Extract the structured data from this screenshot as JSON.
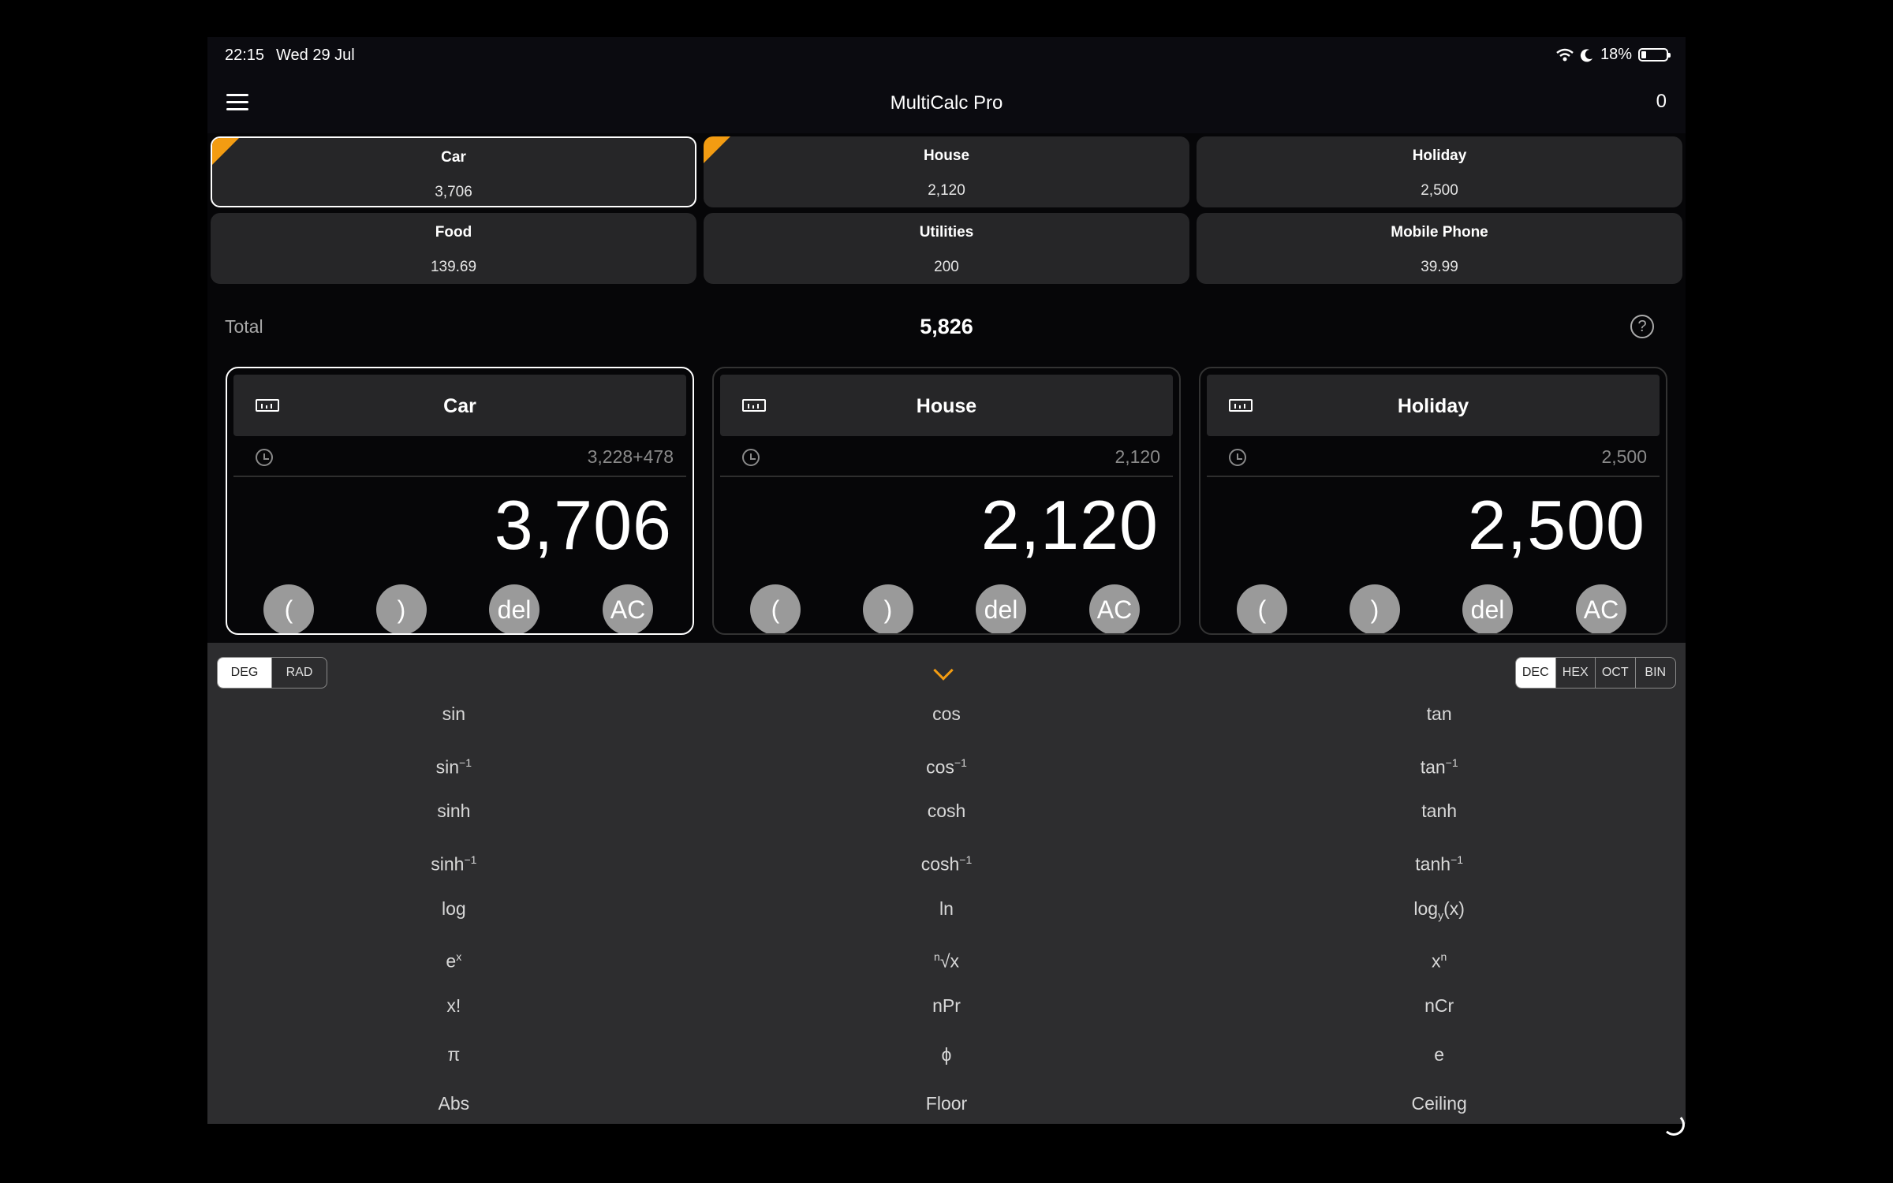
{
  "status": {
    "time": "22:15",
    "date": "Wed 29 Jul",
    "battery": "18%"
  },
  "navbar": {
    "title": "MultiCalc Pro",
    "count": "0"
  },
  "tiles": [
    {
      "name": "Car",
      "value": "3,706",
      "selected": true,
      "flag": true
    },
    {
      "name": "House",
      "value": "2,120",
      "selected": false,
      "flag": true
    },
    {
      "name": "Holiday",
      "value": "2,500",
      "selected": false,
      "flag": false
    },
    {
      "name": "Food",
      "value": "139.69",
      "selected": false,
      "flag": false
    },
    {
      "name": "Utilities",
      "value": "200",
      "selected": false,
      "flag": false
    },
    {
      "name": "Mobile Phone",
      "value": "39.99",
      "selected": false,
      "flag": false
    }
  ],
  "total": {
    "label": "Total",
    "value": "5,826",
    "help_icon": "question-circle-icon"
  },
  "calculators": [
    {
      "title": "Car",
      "history": "3,228+478",
      "display": "3,706",
      "active": true
    },
    {
      "title": "House",
      "history": "2,120",
      "display": "2,120",
      "active": false
    },
    {
      "title": "Holiday",
      "history": "2,500",
      "display": "2,500",
      "active": false
    }
  ],
  "keys": {
    "open": "(",
    "close": ")",
    "del": "del",
    "ac": "AC"
  },
  "angle_mode": {
    "options": [
      "DEG",
      "RAD"
    ],
    "selected": "DEG"
  },
  "base_mode": {
    "options": [
      "DEC",
      "HEX",
      "OCT",
      "BIN"
    ],
    "selected": "DEC"
  },
  "functions": {
    "sin": "sin",
    "cos": "cos",
    "tan": "tan",
    "asin": "sin",
    "acos": "cos",
    "atan": "tan",
    "inv_sup": "−1",
    "sinh": "sinh",
    "cosh": "cosh",
    "tanh": "tanh",
    "asinh": "sinh",
    "acosh": "cosh",
    "atanh": "tanh",
    "log": "log",
    "ln": "ln",
    "logy": "log",
    "logy_sub": "y",
    "logy_arg": "(x)",
    "ex": "e",
    "ex_sup": "x",
    "nroot": "√x",
    "nroot_sup": "n",
    "xn": "x",
    "xn_sup": "n",
    "fact": "x!",
    "npr": "nPr",
    "ncr": "nCr",
    "pi": "π",
    "phi": "ϕ",
    "e": "e",
    "abs": "Abs",
    "floor": "Floor",
    "ceiling": "Ceiling"
  },
  "colors": {
    "accent": "#f39c12",
    "tile_bg": "#262628",
    "panel_bg": "#2d2d2f",
    "key_bg": "#9a9a9a"
  }
}
